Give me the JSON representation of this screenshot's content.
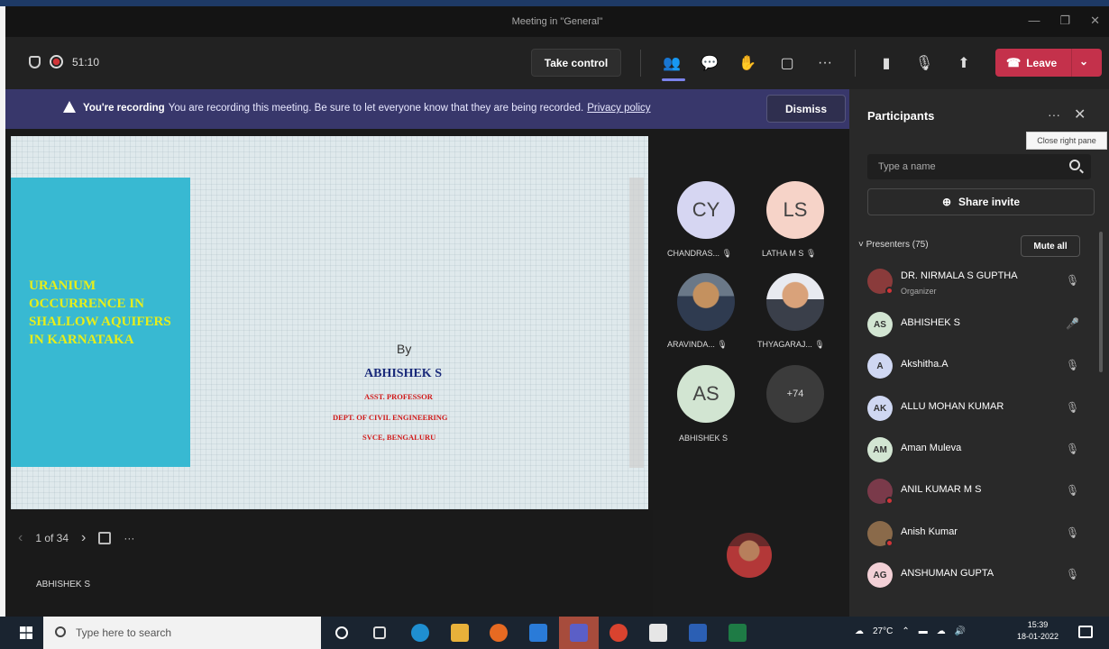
{
  "window": {
    "title": "Meeting in \"General\""
  },
  "toolbar": {
    "timer": "51:10",
    "take_control_label": "Take control",
    "leave_label": "Leave"
  },
  "banner": {
    "heading": "You're recording",
    "message": "You are recording this meeting. Be sure to let everyone know that they are being recorded.",
    "link": "Privacy policy",
    "dismiss_label": "Dismiss"
  },
  "slide": {
    "title": "URANIUM OCCURRENCE IN SHALLOW AQUIFERS IN KARNATAKA",
    "by": "By",
    "author": "ABHISHEK S",
    "role": "ASST. PROFESSOR",
    "dept": "DEPT. OF CIVIL ENGINEERING",
    "college": "SVCE, BENGALURU"
  },
  "slide_nav": {
    "page": "1 of 34"
  },
  "presenter_name": "ABHISHEK S",
  "gallery": {
    "tiles": [
      {
        "initials": "CY",
        "label": "CHANDRAS...",
        "color": "#d6d6f2"
      },
      {
        "initials": "LS",
        "label": "LATHA M S",
        "color": "#f6d3c8"
      },
      {
        "initials": "",
        "label": "ARAVINDA...",
        "color": ""
      },
      {
        "initials": "",
        "label": "THYAGARAJ...",
        "color": ""
      },
      {
        "initials": "AS",
        "label": "ABHISHEK S",
        "color": "#d2e5d2"
      },
      {
        "initials": "+74",
        "label": "",
        "color": "#3b3b3b"
      }
    ]
  },
  "panel": {
    "title": "Participants",
    "tooltip": "Close right pane",
    "search_placeholder": "Type a name",
    "share_invite_label": "Share invite",
    "presenters_header": "Presenters (75)",
    "mute_all_label": "Mute all",
    "participants": [
      {
        "name": "DR. NIRMALA S GUPTHA",
        "sub": "Organizer",
        "initials": "",
        "color": "#8a3b3b"
      },
      {
        "name": "ABHISHEK S",
        "sub": "",
        "initials": "AS",
        "color": "#d2e5d2"
      },
      {
        "name": "Akshitha.A",
        "sub": "",
        "initials": "A",
        "color": "#cfd7f2"
      },
      {
        "name": "ALLU MOHAN KUMAR",
        "sub": "",
        "initials": "AK",
        "color": "#cfd7f2"
      },
      {
        "name": "Aman Muleva",
        "sub": "",
        "initials": "AM",
        "color": "#d2e5d2"
      },
      {
        "name": "ANIL KUMAR M S",
        "sub": "",
        "initials": "",
        "color": "#7a3a4a"
      },
      {
        "name": "Anish Kumar",
        "sub": "",
        "initials": "",
        "color": "#8a6a4a"
      },
      {
        "name": "ANSHUMAN GUPTA",
        "sub": "",
        "initials": "AG",
        "color": "#f2d0d6"
      }
    ]
  },
  "taskbar": {
    "search_placeholder": "Type here to search",
    "temperature": "27°C",
    "time": "15:39",
    "date": "18-01-2022"
  },
  "icons": {
    "people": "people-icon",
    "chat": "chat-icon",
    "reactions": "reactions-icon",
    "rooms": "rooms-icon",
    "camera_off": "camera-off-icon",
    "mic_off": "mic-off-icon",
    "share": "share-icon"
  }
}
